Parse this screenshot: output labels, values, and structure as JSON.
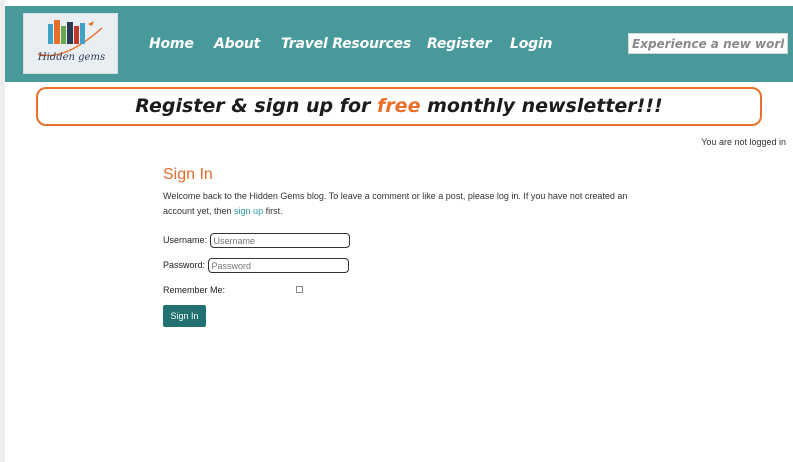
{
  "header": {
    "logo_text": "Hidden gems",
    "nav": [
      "Home",
      "About",
      "Travel Resources",
      "Register",
      "Login"
    ],
    "search_placeholder": "Experience a new world!"
  },
  "banner": {
    "before": "Register & sign up for ",
    "highlight": "free",
    "after": " monthly newsletter!!!"
  },
  "login_status": "You are not logged in",
  "signin": {
    "title": "Sign In",
    "intro_before": "Welcome back to the Hidden Gems blog. To leave a comment or like a post, please log in. If you have not created an account yet, then ",
    "intro_link": "sign up",
    "intro_after": " first.",
    "username_label": "Username:",
    "username_placeholder": "Username",
    "password_label": "Password:",
    "password_placeholder": "Password",
    "remember_label": "Remember Me:",
    "button_label": "Sign In"
  },
  "colors": {
    "header_bg": "#47999a",
    "accent": "#e8702a",
    "button_bg": "#20716f",
    "link": "#2a9aa4"
  }
}
